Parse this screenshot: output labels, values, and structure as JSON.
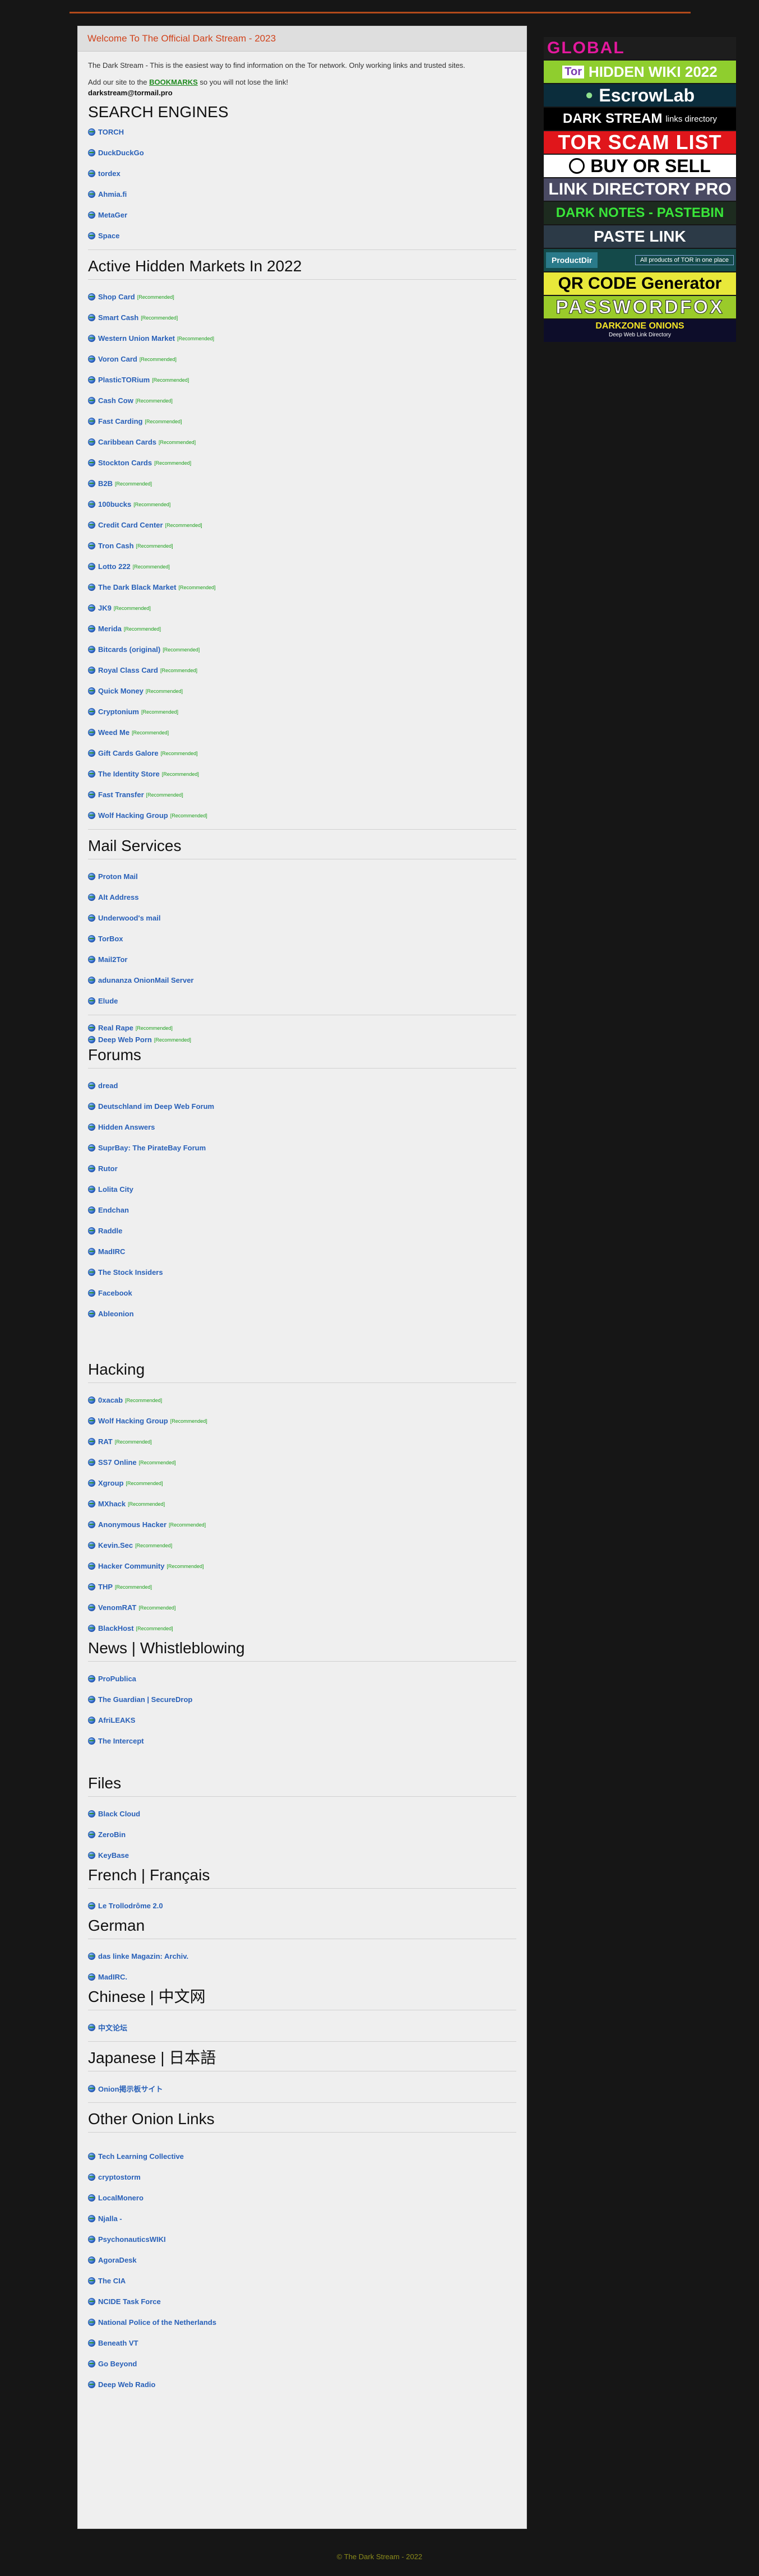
{
  "header": {
    "title": "Welcome To The Official Dark Stream - 2023",
    "intro_text": "The Dark Stream - This is the easiest way to find information on the Tor network. Only working links and trusted sites.",
    "bookmark_prefix": "Add our site to the ",
    "bookmark_link": "BOOKMARKS",
    "bookmark_suffix": " so you will not lose the link!",
    "email": "darkstream@tormail.pro"
  },
  "recommended_tag": "[Recommended]",
  "sections": {
    "search": {
      "title": "SEARCH ENGINES",
      "items": [
        "TORCH",
        "DuckDuckGo",
        "tordex",
        "Ahmia.fi",
        "MetaGer",
        "Space"
      ]
    },
    "markets": {
      "title": "Active Hidden Markets In 2022",
      "items": [
        "Shop Card",
        "Smart Cash",
        "Western Union Market",
        "Voron Card",
        "PlasticTORium",
        "Cash Cow",
        "Fast Carding",
        "Caribbean Cards",
        "Stockton Cards",
        "B2B",
        "100bucks",
        "Credit Card Center",
        "Tron Cash",
        "Lotto 222",
        "The Dark Black Market",
        "JK9",
        "Merida",
        "Bitcards (original)",
        "Royal Class Card",
        "Quick Money",
        "Cryptonium",
        "Weed Me",
        "Gift Cards Galore",
        "The Identity Store",
        "Fast Transfer",
        "Wolf Hacking Group"
      ]
    },
    "mail": {
      "title": "Mail Services",
      "items": [
        "Proton Mail",
        "Alt Address",
        "Underwood's mail",
        "TorBox",
        "Mail2Tor",
        "adunanza OnionMail Server",
        "Elude"
      ],
      "extra": [
        "Real Rape",
        "Deep Web Porn"
      ]
    },
    "forums": {
      "title": "Forums",
      "items": [
        "dread",
        "Deutschland im Deep Web Forum",
        "Hidden Answers",
        "SuprBay: The PirateBay Forum",
        "Rutor",
        "Lolita City",
        "Endchan",
        "Raddle",
        "MadIRC",
        "The Stock Insiders",
        "Facebook",
        "Ableonion"
      ]
    },
    "hacking": {
      "title": "Hacking",
      "items": [
        "0xacab",
        "Wolf Hacking Group",
        "RAT",
        "SS7 Online",
        "Xgroup",
        "MXhack",
        "Anonymous Hacker",
        "Kevin.Sec",
        "Hacker Community",
        "THP",
        "VenomRAT",
        "BlackHost"
      ]
    },
    "news": {
      "title": "News | Whistleblowing",
      "items": [
        "ProPublica",
        "The Guardian | SecureDrop",
        "AfriLEAKS",
        "The Intercept"
      ]
    },
    "files": {
      "title": "Files",
      "items": [
        "Black Cloud",
        "ZeroBin",
        "KeyBase"
      ]
    },
    "french": {
      "title": "French | Français",
      "items": [
        "Le Trollodrôme 2.0"
      ]
    },
    "german": {
      "title": "German",
      "items": [
        "das linke Magazin: Archiv.",
        "MadIRC."
      ]
    },
    "chinese": {
      "title": "Chinese | 中文网",
      "items": [
        "中文论坛"
      ]
    },
    "japanese": {
      "title": "Japanese | 日本語",
      "items": [
        "Onion掲示板サイト"
      ]
    },
    "other": {
      "title": "Other Onion Links",
      "items": [
        "Tech Learning Collective",
        "cryptostorm",
        "LocalMonero",
        "Njalla -",
        "PsychonauticsWIKI",
        "AgoraDesk",
        "The CIA",
        "NCIDE Task Force",
        "National Police of the Netherlands",
        "Beneath VT",
        "Go Beyond",
        "Deep Web Radio"
      ]
    }
  },
  "sidebar": {
    "global": "GLOBAL",
    "hidden_wiki_tag": "Tor",
    "hidden_wiki": "HIDDEN WIKI 2022",
    "escrow": "EscrowLab",
    "dark_stream": "DARK STREAM",
    "dark_stream_sub": "links directory",
    "scam_list": "TOR SCAM LIST",
    "buy_sell": "BUY OR SELL",
    "link_dir_pro": "LINK DIRECTORY PRO",
    "dark_notes": "DARK NOTES - PASTEBIN",
    "paste_link": "PASTE LINK",
    "product_dir": "ProductDir",
    "product_dir_sub": "All products of TOR in one place",
    "qr_code": "QR CODE Generator",
    "password_fox": "PASSWORDFOX",
    "darkzone": "DARKZONE ONIONS",
    "darkzone_sub": "Deep Web Link Directory"
  },
  "footer": "© The Dark Stream - 2022"
}
